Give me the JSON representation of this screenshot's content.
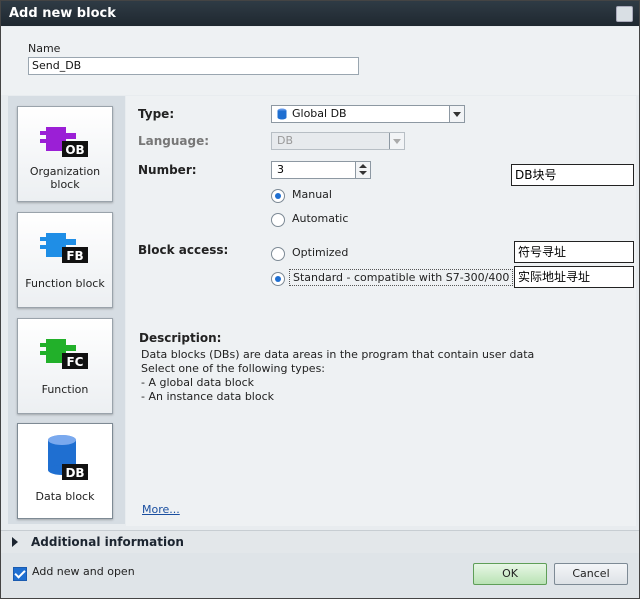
{
  "dialog": {
    "title": "Add new block"
  },
  "name": {
    "label": "Name",
    "value": "Send_DB"
  },
  "block_types": [
    {
      "icon_text": "OB",
      "label": "Organization block",
      "color": "#9b1fd6"
    },
    {
      "icon_text": "FB",
      "label": "Function block",
      "color": "#1f8ee6"
    },
    {
      "icon_text": "FC",
      "label": "Function",
      "color": "#22b02a"
    },
    {
      "icon_text": "DB",
      "label": "Data block",
      "color": "#1f6fd1",
      "selected": true
    }
  ],
  "form": {
    "type_label": "Type:",
    "type_value": "Global DB",
    "language_label": "Language:",
    "language_value": "DB",
    "number_label": "Number:",
    "number_value": "3",
    "number_mode": {
      "manual": "Manual",
      "automatic": "Automatic",
      "selected": "Manual"
    },
    "block_access_label": "Block access:",
    "access": {
      "optimized": "Optimized",
      "standard": "Standard - compatible with S7-300/400",
      "selected": "standard"
    }
  },
  "annotations": {
    "db_number": "DB块号",
    "symbolic": "符号寻址",
    "absolute": "实际地址寻址"
  },
  "description": {
    "title": "Description:",
    "lines": [
      "Data blocks (DBs) are data areas in the program that contain user data",
      "Select one of the following types:",
      "- A global data block",
      "- An instance data block"
    ],
    "more": "More..."
  },
  "additional": {
    "label": "Additional information"
  },
  "footer": {
    "add_open_label": "Add new and open",
    "add_open_checked": true,
    "ok_label": "OK",
    "cancel_label": "Cancel"
  }
}
